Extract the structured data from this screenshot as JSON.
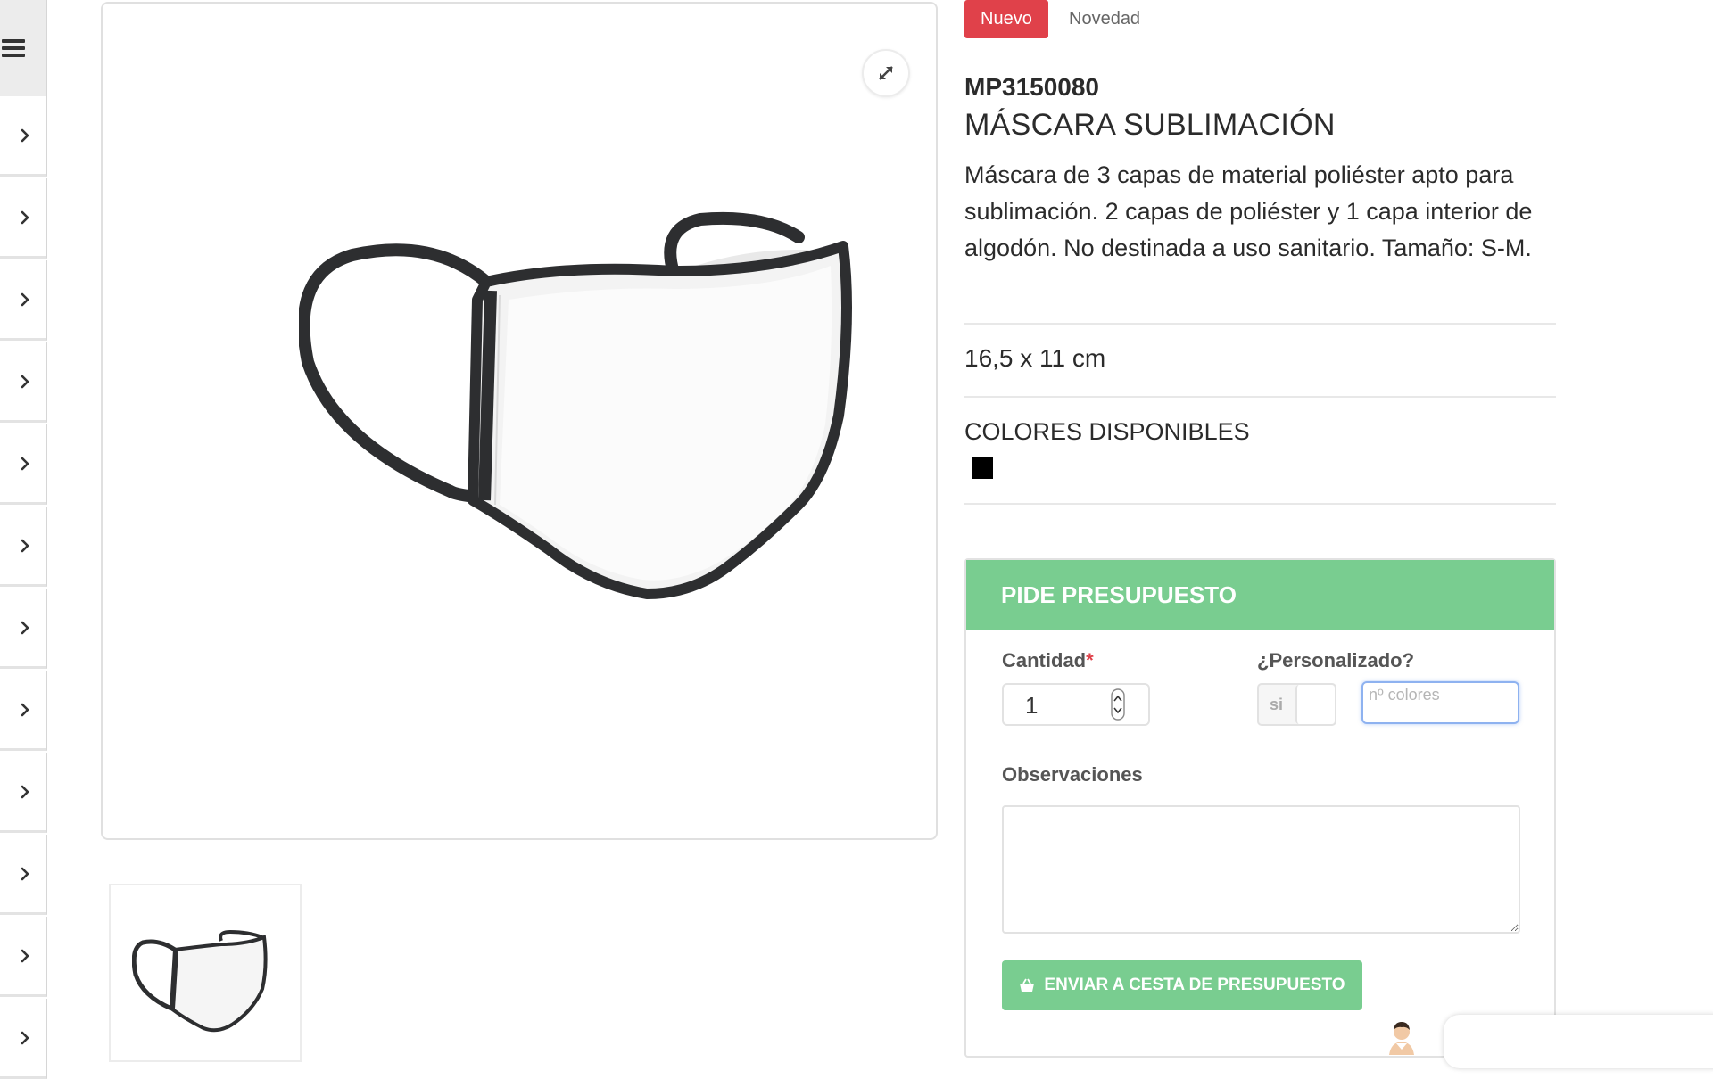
{
  "sidebar": {
    "menu_icon": "hamburger-icon",
    "item_icon": "chevron-right-icon",
    "item_count": 12
  },
  "product": {
    "badges": {
      "new": "Nuevo",
      "novelty": "Novedad"
    },
    "sku": "MP3150080",
    "name": "MÁSCARA SUBLIMACIÓN",
    "description": "Máscara de 3 capas de material poliéster apto para sublimación. 2 capas de poliéster y 1 capa interior de algodón. No destinada a uso sanitario. Tamaño: S-M.",
    "size": "16,5 x 11 cm",
    "colors_heading": "COLORES DISPONIBLES",
    "colors": [
      "#000000"
    ],
    "expand_icon": "expand-icon"
  },
  "quote": {
    "header": "PIDE PRESUPUESTO",
    "quantity_label": "Cantidad",
    "required_mark": "*",
    "quantity_value": "1",
    "customized_label": "¿Personalizado?",
    "toggle_label": "si",
    "colors_placeholder": "nº colores",
    "observations_label": "Observaciones",
    "submit_label": "ENVIAR A CESTA DE PRESUPUESTO",
    "submit_icon": "basket-icon"
  },
  "colors": {
    "accent_green": "#79cd90",
    "badge_red": "#e0414a"
  }
}
